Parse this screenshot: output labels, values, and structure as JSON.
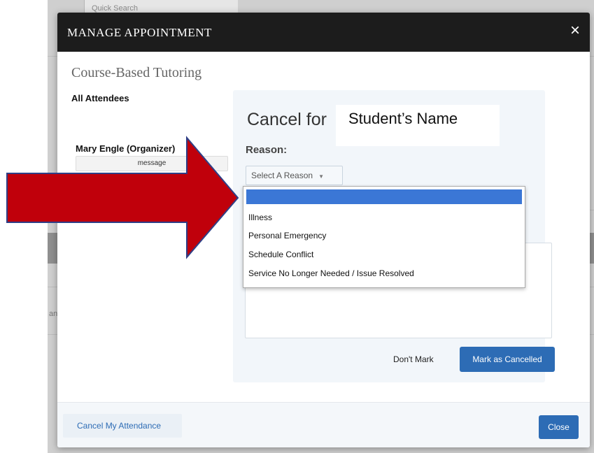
{
  "background": {
    "search_label": "Quick Search",
    "fragment": "an"
  },
  "modal": {
    "title": "MANAGE APPOINTMENT",
    "close_glyph": "×",
    "course_title": "Course-Based Tutoring",
    "attendees_heading": "All Attendees",
    "organizer_name": "Mary Engle (Organizer)",
    "message_label": "message"
  },
  "cancel_panel": {
    "heading": "Cancel for",
    "student_name": "Student’s Name",
    "reason_label": "Reason:",
    "select_placeholder": "Select A Reason",
    "select_caret": "▼",
    "dont_mark_label": "Don't Mark",
    "mark_cancelled_label": "Mark as Cancelled"
  },
  "dropdown": {
    "options": [
      "",
      "Illness",
      "Personal Emergency",
      "Schedule Conflict",
      "Service No Longer Needed / Issue Resolved"
    ]
  },
  "footer": {
    "cancel_attendance_label": "Cancel My Attendance",
    "close_label": "Close"
  },
  "colors": {
    "header_bg": "#1c1c1c",
    "primary_blue": "#2d6cb5",
    "highlight_blue": "#3b77d6",
    "arrow_red": "#c0000b"
  }
}
